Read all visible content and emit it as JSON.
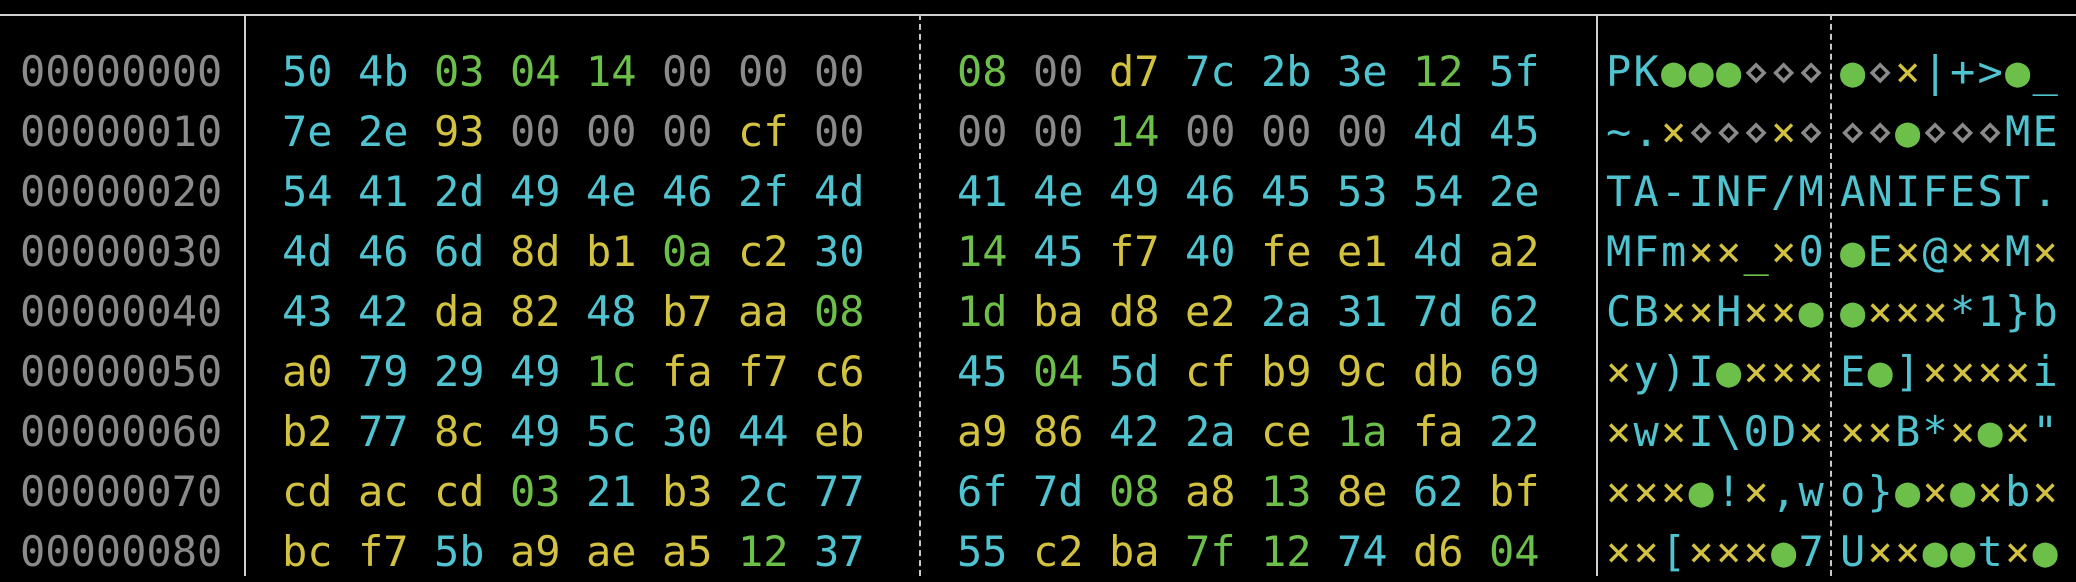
{
  "colors": {
    "background": "#000000",
    "border": "#d0d0d0",
    "offset": "#8a8a8a",
    "null_byte": "#8a8a8a",
    "printable": "#4fc3cf",
    "whitespace_control": "#6cc04a",
    "non_ascii": "#d3c23f"
  },
  "rows": [
    {
      "offset": "00000000",
      "hex1": [
        [
          "50",
          "c-print"
        ],
        [
          "4b",
          "c-print"
        ],
        [
          "03",
          "c-ctrl"
        ],
        [
          "04",
          "c-ctrl"
        ],
        [
          "14",
          "c-ctrl"
        ],
        [
          "00",
          "c-null"
        ],
        [
          "00",
          "c-null"
        ],
        [
          "00",
          "c-null"
        ]
      ],
      "hex2": [
        [
          "08",
          "c-ctrl"
        ],
        [
          "00",
          "c-null"
        ],
        [
          "d7",
          "c-high"
        ],
        [
          "7c",
          "c-print"
        ],
        [
          "2b",
          "c-print"
        ],
        [
          "3e",
          "c-print"
        ],
        [
          "12",
          "c-ctrl"
        ],
        [
          "5f",
          "c-print"
        ]
      ],
      "ascii1": [
        [
          "P",
          "c-print"
        ],
        [
          "K",
          "c-print"
        ],
        [
          "●",
          "c-ctrl"
        ],
        [
          "●",
          "c-ctrl"
        ],
        [
          "●",
          "c-ctrl"
        ],
        [
          "⋄",
          "c-null"
        ],
        [
          "⋄",
          "c-null"
        ],
        [
          "⋄",
          "c-null"
        ]
      ],
      "ascii2": [
        [
          "●",
          "c-ctrl"
        ],
        [
          "⋄",
          "c-null"
        ],
        [
          "×",
          "c-high"
        ],
        [
          "|",
          "c-print"
        ],
        [
          "+",
          "c-print"
        ],
        [
          ">",
          "c-print"
        ],
        [
          "●",
          "c-ctrl"
        ],
        [
          "_",
          "c-print"
        ]
      ]
    },
    {
      "offset": "00000010",
      "hex1": [
        [
          "7e",
          "c-print"
        ],
        [
          "2e",
          "c-print"
        ],
        [
          "93",
          "c-high"
        ],
        [
          "00",
          "c-null"
        ],
        [
          "00",
          "c-null"
        ],
        [
          "00",
          "c-null"
        ],
        [
          "cf",
          "c-high"
        ],
        [
          "00",
          "c-null"
        ]
      ],
      "hex2": [
        [
          "00",
          "c-null"
        ],
        [
          "00",
          "c-null"
        ],
        [
          "14",
          "c-ctrl"
        ],
        [
          "00",
          "c-null"
        ],
        [
          "00",
          "c-null"
        ],
        [
          "00",
          "c-null"
        ],
        [
          "4d",
          "c-print"
        ],
        [
          "45",
          "c-print"
        ]
      ],
      "ascii1": [
        [
          "~",
          "c-print"
        ],
        [
          ".",
          "c-print"
        ],
        [
          "×",
          "c-high"
        ],
        [
          "⋄",
          "c-null"
        ],
        [
          "⋄",
          "c-null"
        ],
        [
          "⋄",
          "c-null"
        ],
        [
          "×",
          "c-high"
        ],
        [
          "⋄",
          "c-null"
        ]
      ],
      "ascii2": [
        [
          "⋄",
          "c-null"
        ],
        [
          "⋄",
          "c-null"
        ],
        [
          "●",
          "c-ctrl"
        ],
        [
          "⋄",
          "c-null"
        ],
        [
          "⋄",
          "c-null"
        ],
        [
          "⋄",
          "c-null"
        ],
        [
          "M",
          "c-print"
        ],
        [
          "E",
          "c-print"
        ]
      ]
    },
    {
      "offset": "00000020",
      "hex1": [
        [
          "54",
          "c-print"
        ],
        [
          "41",
          "c-print"
        ],
        [
          "2d",
          "c-print"
        ],
        [
          "49",
          "c-print"
        ],
        [
          "4e",
          "c-print"
        ],
        [
          "46",
          "c-print"
        ],
        [
          "2f",
          "c-print"
        ],
        [
          "4d",
          "c-print"
        ]
      ],
      "hex2": [
        [
          "41",
          "c-print"
        ],
        [
          "4e",
          "c-print"
        ],
        [
          "49",
          "c-print"
        ],
        [
          "46",
          "c-print"
        ],
        [
          "45",
          "c-print"
        ],
        [
          "53",
          "c-print"
        ],
        [
          "54",
          "c-print"
        ],
        [
          "2e",
          "c-print"
        ]
      ],
      "ascii1": [
        [
          "T",
          "c-print"
        ],
        [
          "A",
          "c-print"
        ],
        [
          "-",
          "c-print"
        ],
        [
          "I",
          "c-print"
        ],
        [
          "N",
          "c-print"
        ],
        [
          "F",
          "c-print"
        ],
        [
          "/",
          "c-print"
        ],
        [
          "M",
          "c-print"
        ]
      ],
      "ascii2": [
        [
          "A",
          "c-print"
        ],
        [
          "N",
          "c-print"
        ],
        [
          "I",
          "c-print"
        ],
        [
          "F",
          "c-print"
        ],
        [
          "E",
          "c-print"
        ],
        [
          "S",
          "c-print"
        ],
        [
          "T",
          "c-print"
        ],
        [
          ".",
          "c-print"
        ]
      ]
    },
    {
      "offset": "00000030",
      "hex1": [
        [
          "4d",
          "c-print"
        ],
        [
          "46",
          "c-print"
        ],
        [
          "6d",
          "c-print"
        ],
        [
          "8d",
          "c-high"
        ],
        [
          "b1",
          "c-high"
        ],
        [
          "0a",
          "c-ctrl"
        ],
        [
          "c2",
          "c-high"
        ],
        [
          "30",
          "c-print"
        ]
      ],
      "hex2": [
        [
          "14",
          "c-ctrl"
        ],
        [
          "45",
          "c-print"
        ],
        [
          "f7",
          "c-high"
        ],
        [
          "40",
          "c-print"
        ],
        [
          "fe",
          "c-high"
        ],
        [
          "e1",
          "c-high"
        ],
        [
          "4d",
          "c-print"
        ],
        [
          "a2",
          "c-high"
        ]
      ],
      "ascii1": [
        [
          "M",
          "c-print"
        ],
        [
          "F",
          "c-print"
        ],
        [
          "m",
          "c-print"
        ],
        [
          "×",
          "c-high"
        ],
        [
          "×",
          "c-high"
        ],
        [
          "_",
          "c-ctrl"
        ],
        [
          "×",
          "c-high"
        ],
        [
          "0",
          "c-print"
        ]
      ],
      "ascii2": [
        [
          "●",
          "c-ctrl"
        ],
        [
          "E",
          "c-print"
        ],
        [
          "×",
          "c-high"
        ],
        [
          "@",
          "c-print"
        ],
        [
          "×",
          "c-high"
        ],
        [
          "×",
          "c-high"
        ],
        [
          "M",
          "c-print"
        ],
        [
          "×",
          "c-high"
        ]
      ]
    },
    {
      "offset": "00000040",
      "hex1": [
        [
          "43",
          "c-print"
        ],
        [
          "42",
          "c-print"
        ],
        [
          "da",
          "c-high"
        ],
        [
          "82",
          "c-high"
        ],
        [
          "48",
          "c-print"
        ],
        [
          "b7",
          "c-high"
        ],
        [
          "aa",
          "c-high"
        ],
        [
          "08",
          "c-ctrl"
        ]
      ],
      "hex2": [
        [
          "1d",
          "c-ctrl"
        ],
        [
          "ba",
          "c-high"
        ],
        [
          "d8",
          "c-high"
        ],
        [
          "e2",
          "c-high"
        ],
        [
          "2a",
          "c-print"
        ],
        [
          "31",
          "c-print"
        ],
        [
          "7d",
          "c-print"
        ],
        [
          "62",
          "c-print"
        ]
      ],
      "ascii1": [
        [
          "C",
          "c-print"
        ],
        [
          "B",
          "c-print"
        ],
        [
          "×",
          "c-high"
        ],
        [
          "×",
          "c-high"
        ],
        [
          "H",
          "c-print"
        ],
        [
          "×",
          "c-high"
        ],
        [
          "×",
          "c-high"
        ],
        [
          "●",
          "c-ctrl"
        ]
      ],
      "ascii2": [
        [
          "●",
          "c-ctrl"
        ],
        [
          "×",
          "c-high"
        ],
        [
          "×",
          "c-high"
        ],
        [
          "×",
          "c-high"
        ],
        [
          "*",
          "c-print"
        ],
        [
          "1",
          "c-print"
        ],
        [
          "}",
          "c-print"
        ],
        [
          "b",
          "c-print"
        ]
      ]
    },
    {
      "offset": "00000050",
      "hex1": [
        [
          "a0",
          "c-high"
        ],
        [
          "79",
          "c-print"
        ],
        [
          "29",
          "c-print"
        ],
        [
          "49",
          "c-print"
        ],
        [
          "1c",
          "c-ctrl"
        ],
        [
          "fa",
          "c-high"
        ],
        [
          "f7",
          "c-high"
        ],
        [
          "c6",
          "c-high"
        ]
      ],
      "hex2": [
        [
          "45",
          "c-print"
        ],
        [
          "04",
          "c-ctrl"
        ],
        [
          "5d",
          "c-print"
        ],
        [
          "cf",
          "c-high"
        ],
        [
          "b9",
          "c-high"
        ],
        [
          "9c",
          "c-high"
        ],
        [
          "db",
          "c-high"
        ],
        [
          "69",
          "c-print"
        ]
      ],
      "ascii1": [
        [
          "×",
          "c-high"
        ],
        [
          "y",
          "c-print"
        ],
        [
          ")",
          "c-print"
        ],
        [
          "I",
          "c-print"
        ],
        [
          "●",
          "c-ctrl"
        ],
        [
          "×",
          "c-high"
        ],
        [
          "×",
          "c-high"
        ],
        [
          "×",
          "c-high"
        ]
      ],
      "ascii2": [
        [
          "E",
          "c-print"
        ],
        [
          "●",
          "c-ctrl"
        ],
        [
          "]",
          "c-print"
        ],
        [
          "×",
          "c-high"
        ],
        [
          "×",
          "c-high"
        ],
        [
          "×",
          "c-high"
        ],
        [
          "×",
          "c-high"
        ],
        [
          "i",
          "c-print"
        ]
      ]
    },
    {
      "offset": "00000060",
      "hex1": [
        [
          "b2",
          "c-high"
        ],
        [
          "77",
          "c-print"
        ],
        [
          "8c",
          "c-high"
        ],
        [
          "49",
          "c-print"
        ],
        [
          "5c",
          "c-print"
        ],
        [
          "30",
          "c-print"
        ],
        [
          "44",
          "c-print"
        ],
        [
          "eb",
          "c-high"
        ]
      ],
      "hex2": [
        [
          "a9",
          "c-high"
        ],
        [
          "86",
          "c-high"
        ],
        [
          "42",
          "c-print"
        ],
        [
          "2a",
          "c-print"
        ],
        [
          "ce",
          "c-high"
        ],
        [
          "1a",
          "c-ctrl"
        ],
        [
          "fa",
          "c-high"
        ],
        [
          "22",
          "c-print"
        ]
      ],
      "ascii1": [
        [
          "×",
          "c-high"
        ],
        [
          "w",
          "c-print"
        ],
        [
          "×",
          "c-high"
        ],
        [
          "I",
          "c-print"
        ],
        [
          "\\",
          "c-print"
        ],
        [
          "0",
          "c-print"
        ],
        [
          "D",
          "c-print"
        ],
        [
          "×",
          "c-high"
        ]
      ],
      "ascii2": [
        [
          "×",
          "c-high"
        ],
        [
          "×",
          "c-high"
        ],
        [
          "B",
          "c-print"
        ],
        [
          "*",
          "c-print"
        ],
        [
          "×",
          "c-high"
        ],
        [
          "●",
          "c-ctrl"
        ],
        [
          "×",
          "c-high"
        ],
        [
          "\"",
          "c-print"
        ]
      ]
    },
    {
      "offset": "00000070",
      "hex1": [
        [
          "cd",
          "c-high"
        ],
        [
          "ac",
          "c-high"
        ],
        [
          "cd",
          "c-high"
        ],
        [
          "03",
          "c-ctrl"
        ],
        [
          "21",
          "c-print"
        ],
        [
          "b3",
          "c-high"
        ],
        [
          "2c",
          "c-print"
        ],
        [
          "77",
          "c-print"
        ]
      ],
      "hex2": [
        [
          "6f",
          "c-print"
        ],
        [
          "7d",
          "c-print"
        ],
        [
          "08",
          "c-ctrl"
        ],
        [
          "a8",
          "c-high"
        ],
        [
          "13",
          "c-ctrl"
        ],
        [
          "8e",
          "c-high"
        ],
        [
          "62",
          "c-print"
        ],
        [
          "bf",
          "c-high"
        ]
      ],
      "ascii1": [
        [
          "×",
          "c-high"
        ],
        [
          "×",
          "c-high"
        ],
        [
          "×",
          "c-high"
        ],
        [
          "●",
          "c-ctrl"
        ],
        [
          "!",
          "c-print"
        ],
        [
          "×",
          "c-high"
        ],
        [
          ",",
          "c-print"
        ],
        [
          "w",
          "c-print"
        ]
      ],
      "ascii2": [
        [
          "o",
          "c-print"
        ],
        [
          "}",
          "c-print"
        ],
        [
          "●",
          "c-ctrl"
        ],
        [
          "×",
          "c-high"
        ],
        [
          "●",
          "c-ctrl"
        ],
        [
          "×",
          "c-high"
        ],
        [
          "b",
          "c-print"
        ],
        [
          "×",
          "c-high"
        ]
      ]
    },
    {
      "offset": "00000080",
      "hex1": [
        [
          "bc",
          "c-high"
        ],
        [
          "f7",
          "c-high"
        ],
        [
          "5b",
          "c-print"
        ],
        [
          "a9",
          "c-high"
        ],
        [
          "ae",
          "c-high"
        ],
        [
          "a5",
          "c-high"
        ],
        [
          "12",
          "c-ctrl"
        ],
        [
          "37",
          "c-print"
        ]
      ],
      "hex2": [
        [
          "55",
          "c-print"
        ],
        [
          "c2",
          "c-high"
        ],
        [
          "ba",
          "c-high"
        ],
        [
          "7f",
          "c-ctrl"
        ],
        [
          "12",
          "c-ctrl"
        ],
        [
          "74",
          "c-print"
        ],
        [
          "d6",
          "c-high"
        ],
        [
          "04",
          "c-ctrl"
        ]
      ],
      "ascii1": [
        [
          "×",
          "c-high"
        ],
        [
          "×",
          "c-high"
        ],
        [
          "[",
          "c-print"
        ],
        [
          "×",
          "c-high"
        ],
        [
          "×",
          "c-high"
        ],
        [
          "×",
          "c-high"
        ],
        [
          "●",
          "c-ctrl"
        ],
        [
          "7",
          "c-print"
        ]
      ],
      "ascii2": [
        [
          "U",
          "c-print"
        ],
        [
          "×",
          "c-high"
        ],
        [
          "×",
          "c-high"
        ],
        [
          "●",
          "c-ctrl"
        ],
        [
          "●",
          "c-ctrl"
        ],
        [
          "t",
          "c-print"
        ],
        [
          "×",
          "c-high"
        ],
        [
          "●",
          "c-ctrl"
        ]
      ]
    }
  ]
}
